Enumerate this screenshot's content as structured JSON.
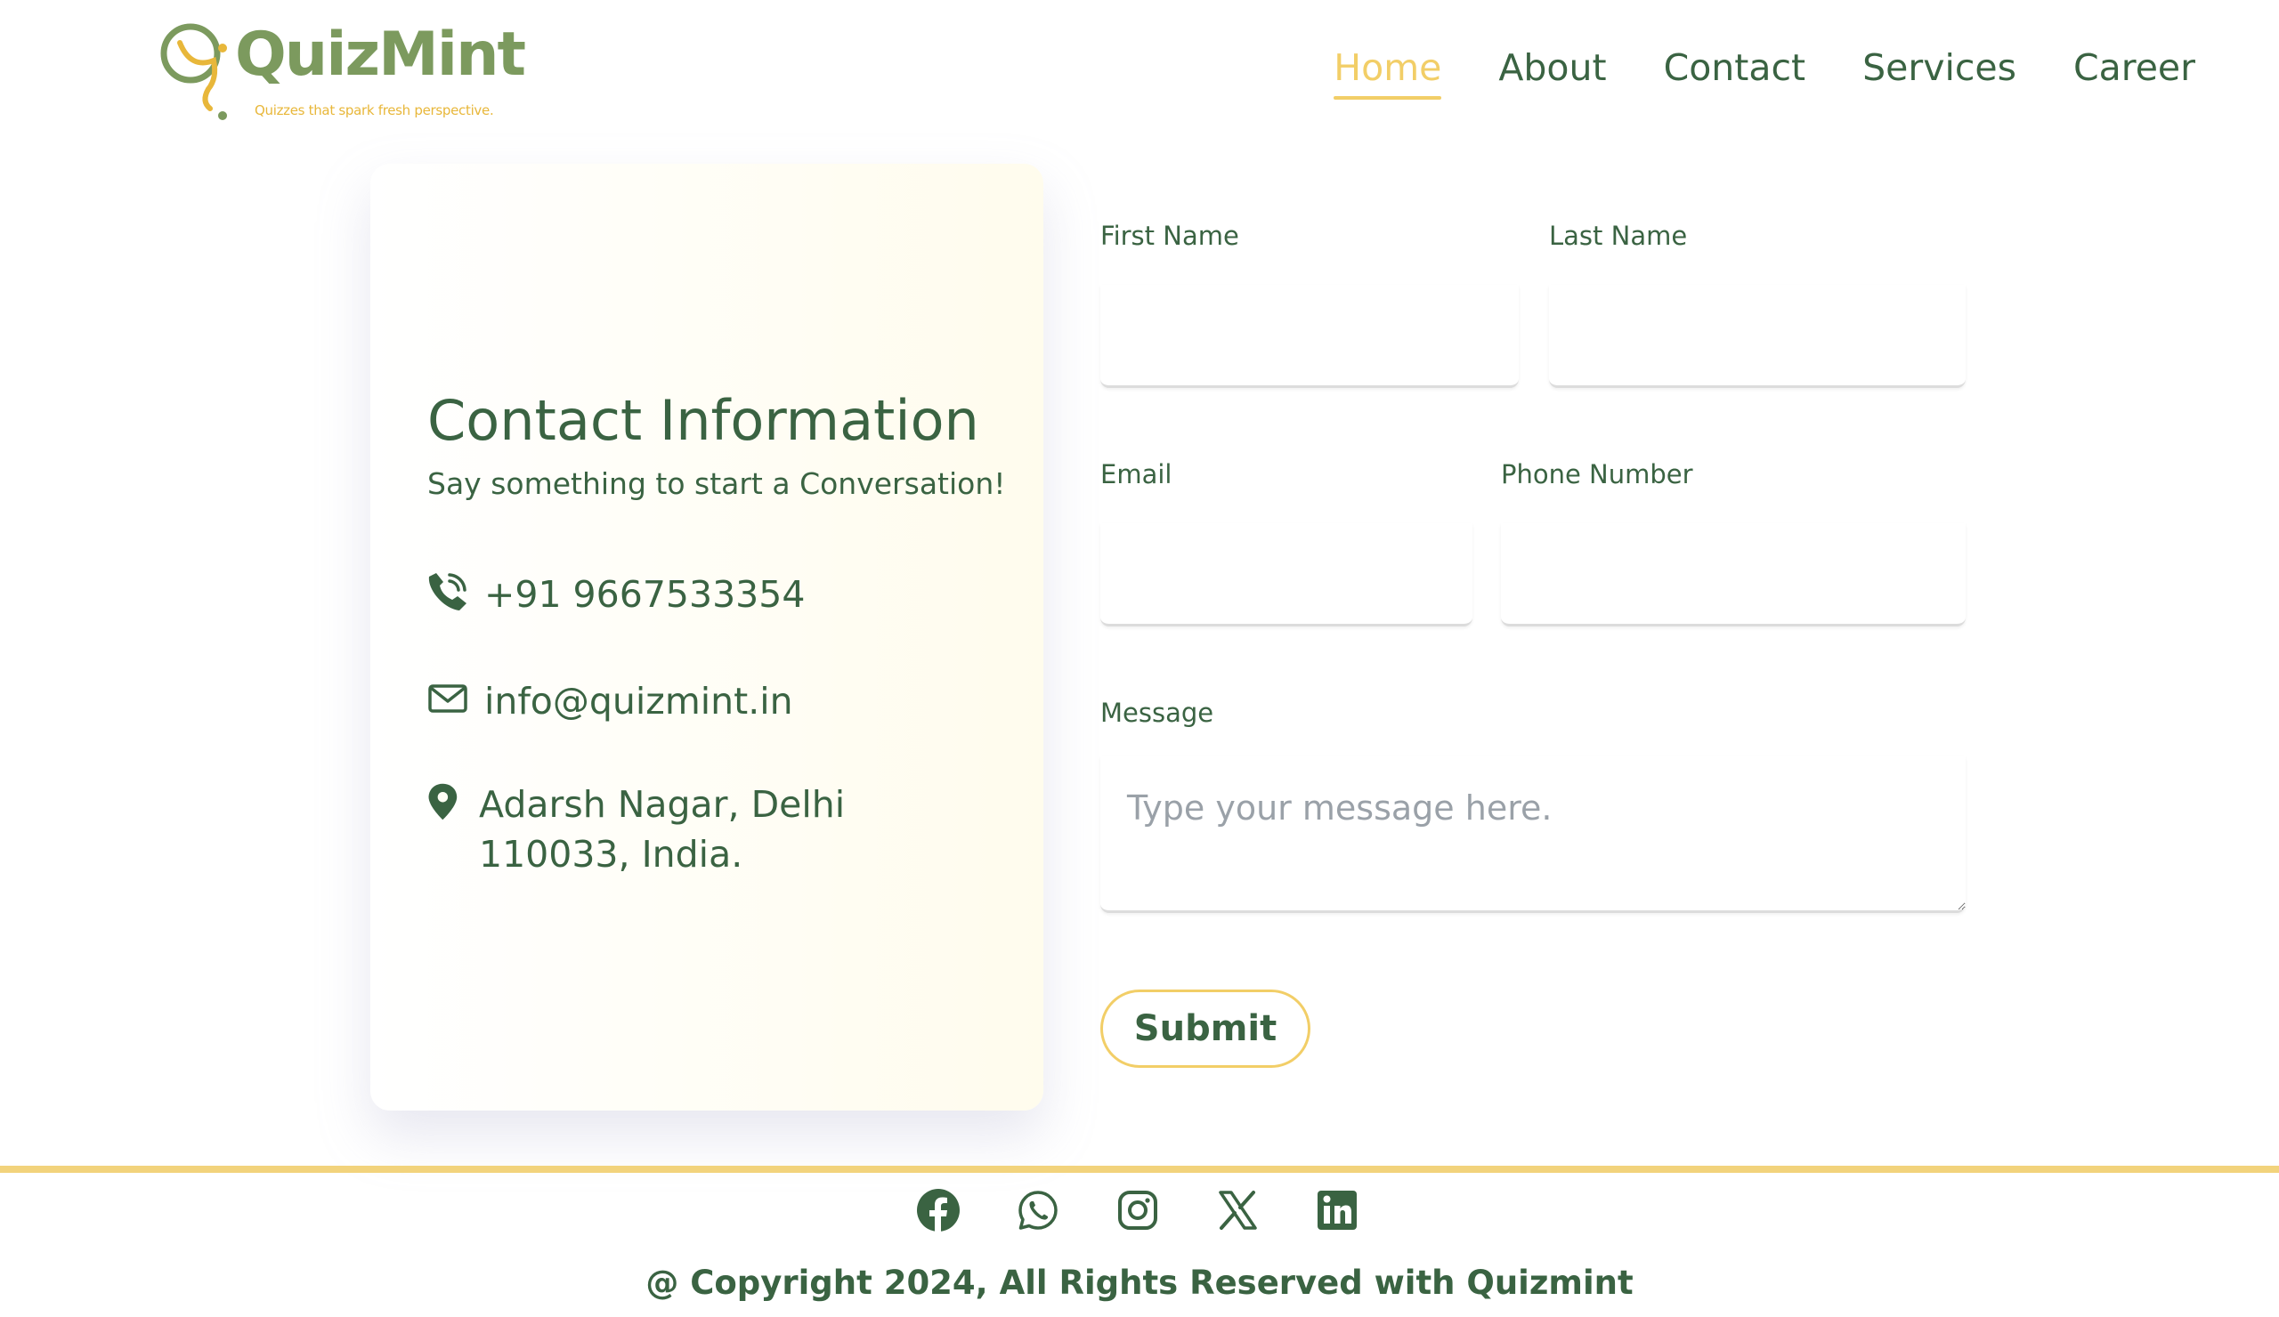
{
  "brand": {
    "name": "QuizMint",
    "tagline": "Quizzes that spark fresh perspective.",
    "colors": {
      "primary": "#3a6342",
      "accent": "#f2ce67",
      "logo": "#7c9a5e"
    }
  },
  "nav": {
    "items": [
      {
        "label": "Home",
        "active": true
      },
      {
        "label": "About"
      },
      {
        "label": "Contact"
      },
      {
        "label": "Services"
      },
      {
        "label": "Career"
      }
    ]
  },
  "contact_info": {
    "title": "Contact Information",
    "subtitle": "Say something to start a Conversation!",
    "phone": {
      "icon": "phone-call-icon",
      "text": "+91 9667533354"
    },
    "email": {
      "icon": "mail-icon",
      "text": "info@quizmint.in"
    },
    "address": {
      "icon": "map-pin-icon",
      "text": "Adarsh Nagar, Delhi 110033, India."
    }
  },
  "form": {
    "first_name": {
      "label": "First Name",
      "value": ""
    },
    "last_name": {
      "label": "Last Name",
      "value": ""
    },
    "email": {
      "label": "Email",
      "value": ""
    },
    "phone": {
      "label": "Phone Number",
      "value": ""
    },
    "message": {
      "label": "Message",
      "placeholder": "Type your message here.",
      "value": ""
    },
    "submit_label": "Submit"
  },
  "footer": {
    "social": [
      "facebook-icon",
      "whatsapp-icon",
      "instagram-icon",
      "x-icon",
      "linkedin-icon"
    ],
    "copyright": "@ Copyright 2024, All Rights Reserved with Quizmint"
  }
}
